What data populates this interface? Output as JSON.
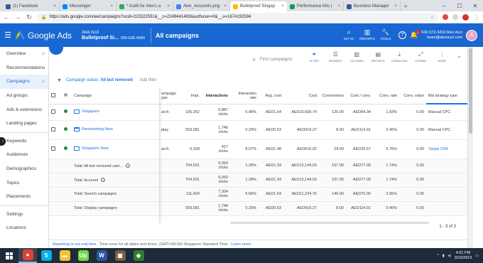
{
  "browser": {
    "tabs": [
      {
        "label": "(1) Facebook",
        "color": "#3b5998"
      },
      {
        "label": "Messenger",
        "color": "#0084ff"
      },
      {
        "label": "* Audit for Alex's a",
        "color": "#34a853"
      },
      {
        "label": "Alex_Accounts.png",
        "color": "#4285f4"
      },
      {
        "label": "Bulletproof Singap",
        "color": "#fbbc04",
        "active": true
      },
      {
        "label": "Performance Kits |",
        "color": "#0f9d58"
      },
      {
        "label": "Business Manager",
        "color": "#3b5998"
      }
    ],
    "url": "https://ads.google.com/aw/campaigns?ocid=223322551&__c=2249441483&authuser=0&__u=1674192594"
  },
  "ads_header": {
    "product": "Google Ads",
    "account_owner": "Alex Azzi",
    "account_name": "Bulletproof Si...",
    "account_id": "300-636-4550",
    "page_title": "All campaigns",
    "tools": [
      {
        "label": "GO TO",
        "icon": "search-icon"
      },
      {
        "label": "REPORTS",
        "icon": "bar-chart-icon"
      },
      {
        "label": "TOOLS",
        "icon": "wrench-icon"
      }
    ],
    "user_phone_name": "542-572-3263 Alex Azzi",
    "user_email": "team@alexazzi.com",
    "avatar_letter": "A",
    "notification_count": "1"
  },
  "sidebar": {
    "items": [
      {
        "label": "Overview",
        "home": true
      },
      {
        "label": "Recommendations"
      },
      {
        "label": "Campaigns",
        "home": true,
        "selected": true
      },
      {
        "label": "Ad groups"
      },
      {
        "label": "Ads & extensions"
      },
      {
        "label": "Landing pages"
      },
      {
        "label": "Keywords"
      },
      {
        "label": "Audiences"
      },
      {
        "label": "Demographics"
      },
      {
        "label": "Topics"
      },
      {
        "label": "Placements"
      },
      {
        "label": "Settings"
      },
      {
        "label": "Locations"
      }
    ]
  },
  "toolbar": {
    "search_placeholder": "Find campaigns",
    "buttons": [
      {
        "label": "FILTER",
        "icon": "filter-icon",
        "active": true
      },
      {
        "label": "SEGMENT",
        "icon": "segment-icon"
      },
      {
        "label": "COLUMNS",
        "icon": "columns-icon"
      },
      {
        "label": "REPORTS",
        "icon": "reports-icon"
      },
      {
        "label": "DOWNLOAD",
        "icon": "download-icon"
      },
      {
        "label": "EXPAND",
        "icon": "expand-icon"
      },
      {
        "label": "MORE",
        "icon": "more-icon"
      }
    ]
  },
  "filter": {
    "prefix": "Campaign status:",
    "value": "All but removed",
    "add_label": "Add filter"
  },
  "table": {
    "headers": [
      "Campaign",
      "Campaign type",
      "Impr.",
      "Interactions",
      "Interaction rate",
      "Avg. cost",
      "Cost",
      "Conversions",
      "Cost / conv.",
      "Conv. rate",
      "Conv. value",
      "Bid strategy type"
    ],
    "header_visible": [
      "Campaign",
      "ampaign ype",
      "Impr.",
      "Interactions",
      "Interaction rate",
      "Avg. cost",
      "Cost",
      "Conversions",
      "Cost / conv.",
      "Conv. rate",
      "Conv. value",
      "Bid strategy type"
    ],
    "campaigns": [
      {
        "name": "Singapore",
        "kind": "search",
        "type": "arch",
        "impr": "106,252",
        "interactions": "6,887",
        "interactions_unit": "clicks",
        "rate": "6.48%",
        "avg_cost": "AED1.54",
        "cost": "AED10,608.74",
        "conversions": "125.00",
        "cost_conv": "AED84.34",
        "conv_rate": "1.83%",
        "conv_value": "0.00",
        "bid": "Manual CPC"
      },
      {
        "name": "Remarketing New",
        "kind": "display",
        "type": "play",
        "impr": "593,081",
        "interactions": "1,746",
        "interactions_unit": "clicks",
        "rate": "0.29%",
        "avg_cost": "AED0.53",
        "cost": "AED919.27",
        "conversions": "8.00",
        "cost_conv": "AED114.91",
        "conv_rate": "0.46%",
        "conv_value": "0.00",
        "bid": "Manual CPC"
      },
      {
        "name": "Singapore New",
        "kind": "search",
        "type": "arch",
        "impr": "5,168",
        "interactions": "417",
        "interactions_unit": "clicks",
        "rate": "8.07%",
        "avg_cost": "AED1.48",
        "cost": "AED616.02",
        "conversions": "24.00",
        "cost_conv": "AED25.67",
        "conv_rate": "5.76%",
        "conv_value": "0.00",
        "bid": "Target CPA",
        "bid_link": true
      }
    ],
    "totals": [
      {
        "label": "Total: All but removed cam...",
        "impr": "704,501",
        "interactions": "9,050",
        "interactions_unit": "clicks",
        "rate": "1.28%",
        "avg_cost": "AED1.34",
        "cost": "AED12,144.03",
        "conversions": "157.00",
        "cost_conv": "AED77.09",
        "conv_rate": "1.74%",
        "conv_value": "0.00"
      },
      {
        "label": "Total: Account",
        "impr": "704,501",
        "interactions": "9,050",
        "interactions_unit": "clicks",
        "rate": "1.28%",
        "avg_cost": "AED1.34",
        "cost": "AED12,144.03",
        "conversions": "157.00",
        "cost_conv": "AED77.09",
        "conv_rate": "1.74%",
        "conv_value": "0.00"
      },
      {
        "label": "Total: Search campaigns",
        "impr": "111,420",
        "interactions": "7,304",
        "interactions_unit": "clicks",
        "rate": "6.56%",
        "avg_cost": "AED1.54",
        "cost": "AED11,224.76",
        "conversions": "149.00",
        "cost_conv": "AED75.06",
        "conv_rate": "2.05%",
        "conv_value": "0.00"
      },
      {
        "label": "Total: Display campaigns",
        "impr": "593,081",
        "interactions": "1,746",
        "interactions_unit": "clicks",
        "rate": "0.29%",
        "avg_cost": "AED0.53",
        "cost": "AED919.27",
        "conversions": "8.00",
        "cost_conv": "AED114.91",
        "conv_rate": "0.46%",
        "conv_value": "0.00"
      }
    ],
    "pagination": "1 - 3 of 3"
  },
  "footer": {
    "realtime": "Reporting is not real-time.",
    "timezone": "Time zone for all dates and times: (GMT+08:00) Singapore Standard Time.",
    "learn_more": "Learn more"
  },
  "taskbar": {
    "apps": [
      {
        "icon": "chrome-icon",
        "color": "#db4437",
        "glyph": "●"
      },
      {
        "icon": "skype-icon",
        "color": "#00aff0",
        "glyph": "S"
      },
      {
        "icon": "file-explorer-icon",
        "color": "#f4c430",
        "glyph": "▬"
      },
      {
        "icon": "upwork-icon",
        "color": "#6fda44",
        "glyph": "Up"
      },
      {
        "icon": "word-icon",
        "color": "#2b579a",
        "glyph": "W"
      },
      {
        "icon": "photos-icon",
        "color": "#7a5c3e",
        "glyph": "▣"
      },
      {
        "icon": "app-icon",
        "color": "#2e7d32",
        "glyph": "◆"
      }
    ],
    "time": "4:01 PM",
    "date": "3/15/2019"
  }
}
